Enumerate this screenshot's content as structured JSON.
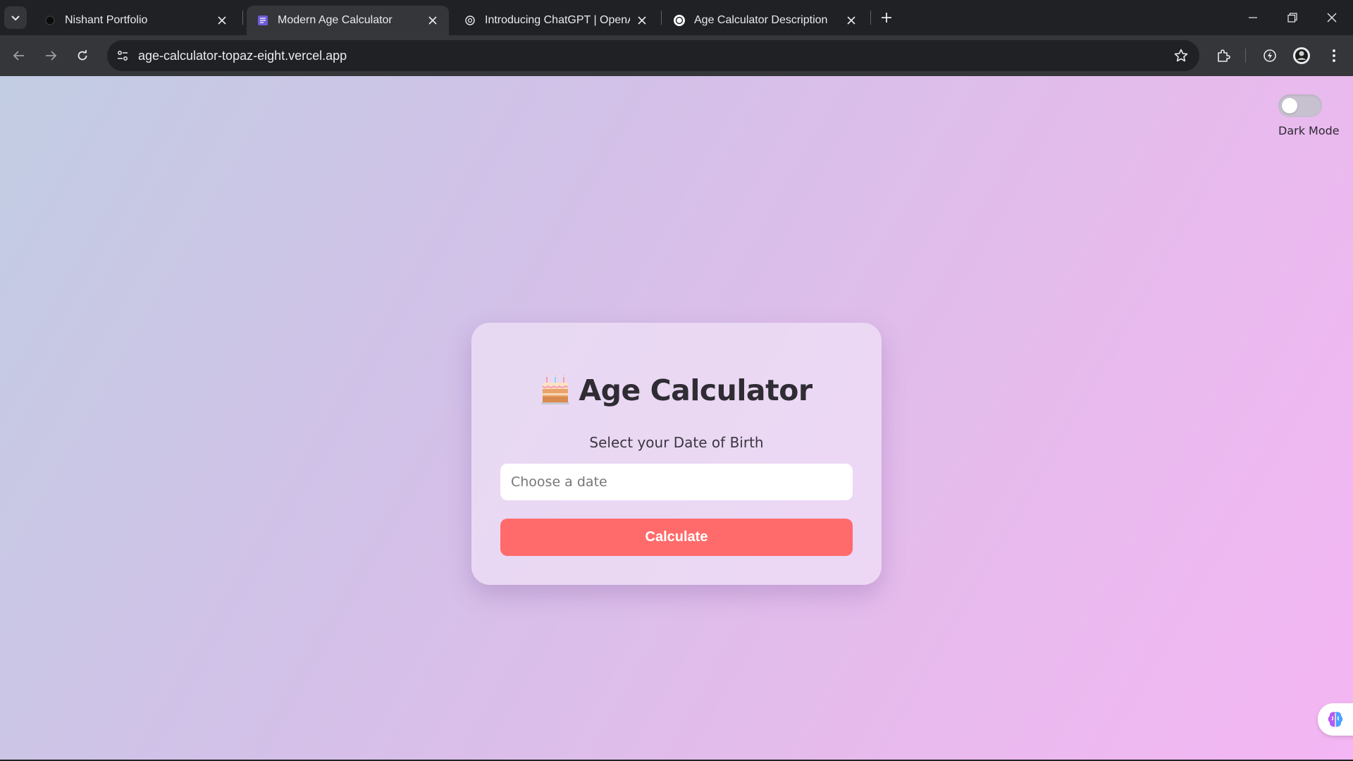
{
  "browser": {
    "tabs": [
      {
        "title": "Nishant Portfolio",
        "active": false,
        "favicon": "dark-circle-icon"
      },
      {
        "title": "Modern Age Calculator",
        "active": true,
        "favicon": "page-icon"
      },
      {
        "title": "Introducing ChatGPT | OpenAI",
        "active": false,
        "favicon": "openai-icon"
      },
      {
        "title": "Age Calculator Description",
        "active": false,
        "favicon": "chatgpt-icon"
      }
    ],
    "url": "age-calculator-topaz-eight.vercel.app"
  },
  "page": {
    "dark_mode_label": "Dark Mode",
    "dark_mode_on": false,
    "title": "Age Calculator",
    "subtitle": "Select your Date of Birth",
    "date_placeholder": "Choose a date",
    "calculate_label": "Calculate"
  },
  "colors": {
    "accent_button": "#ff6b6b",
    "gradient_start": "#c2cde3",
    "gradient_end": "#f4b6f4"
  }
}
